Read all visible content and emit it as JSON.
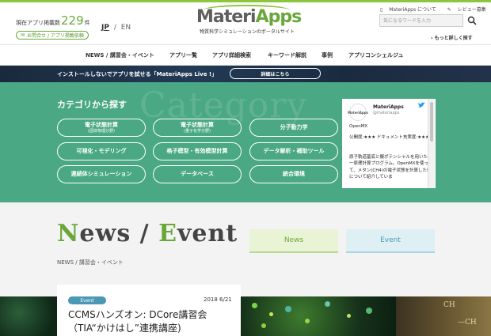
{
  "header": {
    "count_prefix": "現在アプリ掲載数",
    "count_value": "229",
    "count_suffix": "件",
    "contact_label": "お問合せ / アプリ掲載依頼",
    "lang_jp": "JP",
    "lang_sep": "/",
    "lang_en": "EN",
    "logo_main_a": "Materi",
    "logo_main_b": "Apps",
    "logo_sub": "物質科学シミュレーションのポータルサイト",
    "about_link": "MateriApps について",
    "review_link": "レビュー募集",
    "search_placeholder": "気になるワードを入力",
    "more_search": "もっと詳しく探す"
  },
  "nav": {
    "items": [
      "NEWS / 講習会・イベント",
      "アプリ一覧",
      "アプリ詳細検索",
      "キーワード解説",
      "事例",
      "アプリコンシェルジュ"
    ]
  },
  "live_banner": {
    "text": "インストールしないでアプリを試せる「MateriApps Live !」",
    "button": "詳細はこちら"
  },
  "category": {
    "bg_word": "Category",
    "title": "カテゴリから探す",
    "buttons": [
      {
        "label": "電子状態計算",
        "sub": "(固体物理分野)"
      },
      {
        "label": "電子状態計算",
        "sub": "(量子化学分野)"
      },
      {
        "label": "分子動力学",
        "sub": ""
      },
      {
        "label": "可視化・モデリング",
        "sub": ""
      },
      {
        "label": "格子模型・有効模型計算",
        "sub": ""
      },
      {
        "label": "データ解析・補助ツール",
        "sub": ""
      },
      {
        "label": "連続体シミュレーション",
        "sub": ""
      },
      {
        "label": "データベース",
        "sub": ""
      },
      {
        "label": "統合環境",
        "sub": ""
      }
    ]
  },
  "twitter": {
    "avatar": "MateriApps",
    "name": "MateriApps",
    "handle": "@materiapps",
    "line1": "OpenMX",
    "line2": "公開度:★★★ ドキュメント充実度:★★★",
    "line3": "原子軌道基底と擬ポテンシャルを用いた第一原理計算プログラム。OpenMXを使って、メタン(CH4)の電子状態を計算した例について紹介していま"
  },
  "news": {
    "heading_n": "N",
    "heading_ews": "ews / ",
    "heading_e": "E",
    "heading_vent": "vent",
    "breadcrumb": "NEWS / 講習会・イベント",
    "tab_news": "News",
    "tab_event": "Event"
  },
  "card": {
    "badge": "Event",
    "date": "2018 6/21",
    "title": "CCMSハンズオン: DCore講習会 （TIA“かけはし”連携講座)"
  },
  "hero": {
    "mol1": "CH",
    "mol2": "—CH"
  }
}
